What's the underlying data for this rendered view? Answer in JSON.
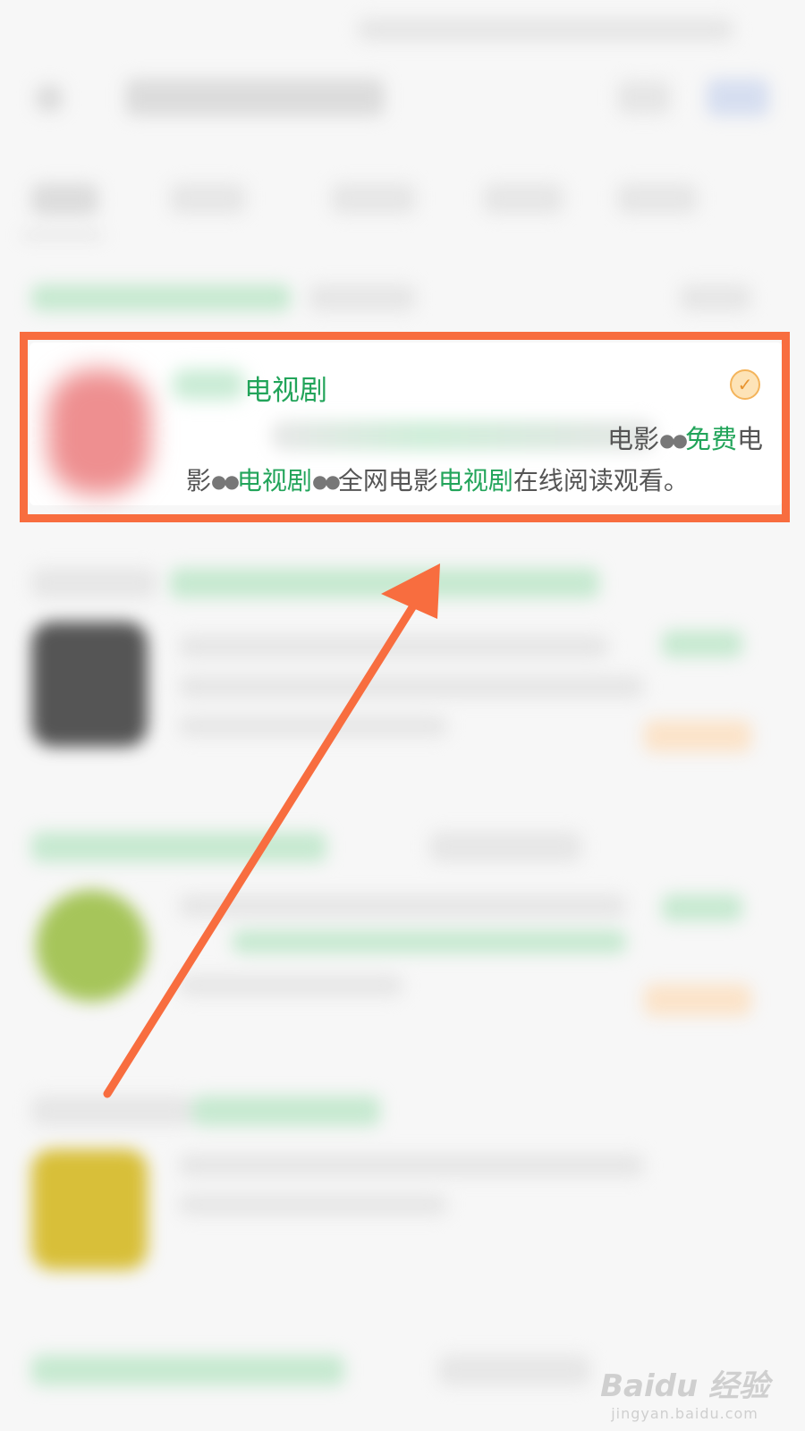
{
  "result_card": {
    "title": "电视剧",
    "desc_line1": {
      "a": "电影",
      "b": "免费",
      "c": "电"
    },
    "desc_line2": {
      "a": "影",
      "b": "电视剧",
      "c": "全网电影",
      "d": "电视剧",
      "e": "在线阅读观看。"
    },
    "eyes": "●●"
  },
  "check_icon": "✓",
  "watermark": {
    "logo": "Baidu 经验",
    "url": "jingyan.baidu.com"
  },
  "colors": {
    "highlight": "#f86d3f",
    "keyword_green": "#22a45a",
    "check_orange": "#f4b45b"
  }
}
